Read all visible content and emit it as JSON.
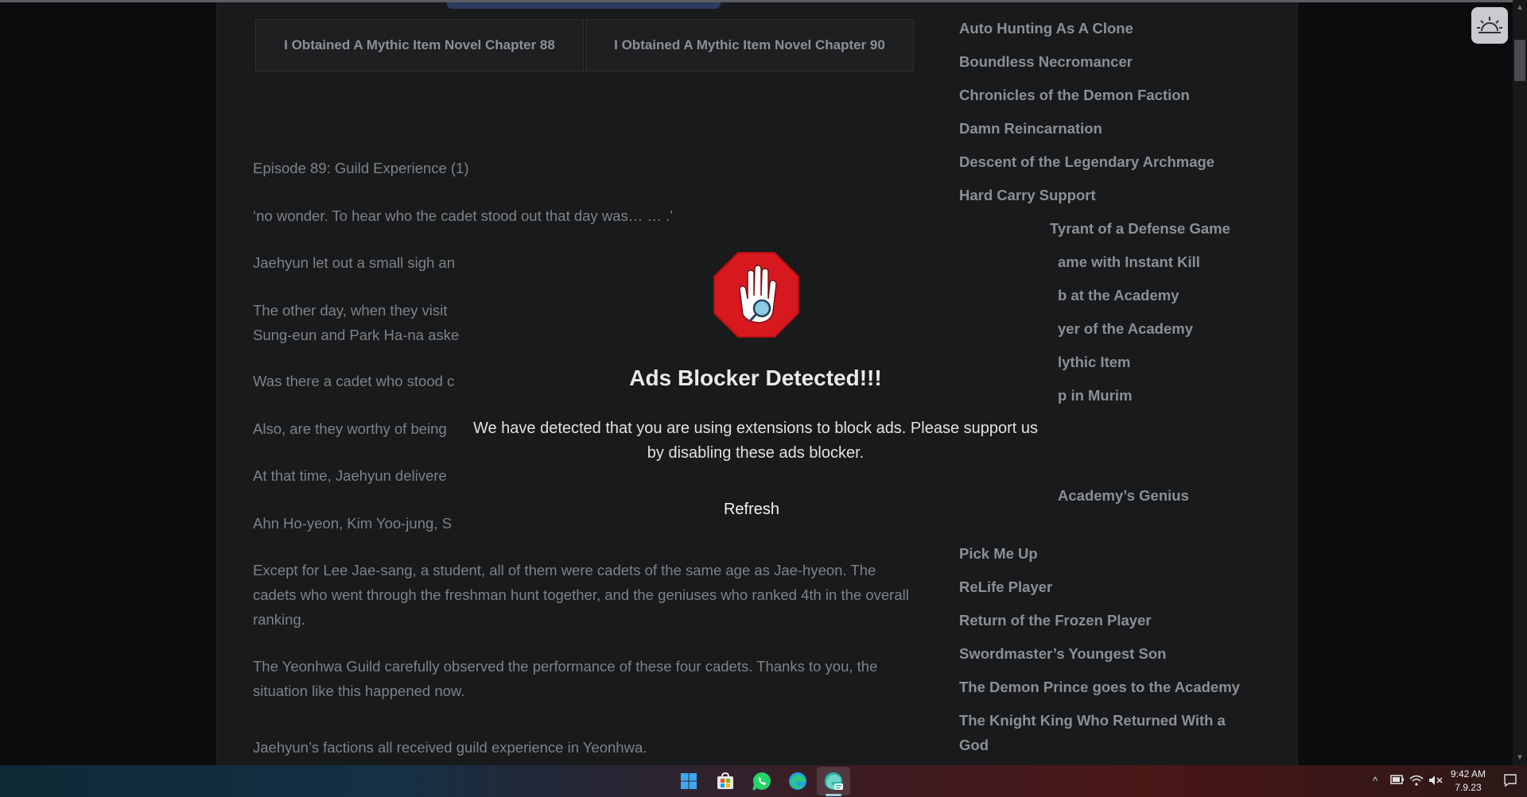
{
  "nav": {
    "prev_label": "I Obtained A Mythic Item Novel Chapter 88",
    "next_label": "I Obtained A Mythic Item Novel Chapter 90"
  },
  "article": {
    "episode_title": "Episode 89: Guild Experience (1)",
    "p1": "‘no wonder. To hear who the cadet stood out that day was… … .’",
    "p2": "Jaehyun let out a small sigh an",
    "p3a": "The other day, when they visit",
    "p3b": "Sung-eun and Park Ha-na aske",
    "p4": "Was there a cadet who stood c",
    "p5": "Also, are they worthy of being",
    "p6": "At that time, Jaehyun delivere",
    "p7": "Ahn Ho-yeon, Kim Yoo-jung, S",
    "p8": "Except for Lee Jae-sang, a student, all of them were cadets of the same age as Jae-hyeon. The cadets who went through the freshman hunt together, and the geniuses who ranked 4th in the overall ranking.",
    "p9": "The Yeonhwa Guild carefully observed the performance of these four cadets. Thanks to you, the situation like this happened now.",
    "p10": "Jaehyun’s factions all received guild experience in Yeonhwa."
  },
  "sidebar": {
    "items": [
      "Auto Hunting As A Clone",
      "Boundless Necromancer",
      "Chronicles of the Demon Faction",
      "Damn Reincarnation",
      "Descent of the Legendary Archmage",
      "Hard Carry Support",
      "Tyrant of a Defense Game",
      "ame with Instant Kill",
      "b at the Academy",
      "yer of the Academy",
      "lythic Item",
      "p in Murim",
      "Academy’s Genius",
      "Pick Me Up",
      "ReLife Player",
      "Return of the Frozen Player",
      "Swordmaster’s Youngest Son",
      "The Demon Prince goes to the Academy",
      "The Knight King Who Returned With a God"
    ]
  },
  "modal": {
    "title": "Ads Blocker Detected!!!",
    "message": "We have detected that you are using extensions to block ads. Please support us by disabling these ads blocker.",
    "refresh_label": "Refresh",
    "icon": "stop-hand-icon"
  },
  "taskbar": {
    "icons": [
      "windows-start-icon",
      "microsoft-store-icon",
      "whatsapp-icon",
      "edge-icon",
      "edge-active-icon"
    ],
    "time": "9:42 AM",
    "date": "7.9.23"
  },
  "colors": {
    "stop_red": "#d7191f",
    "background": "#0b0c0d",
    "content_bg": "#181a1b"
  }
}
